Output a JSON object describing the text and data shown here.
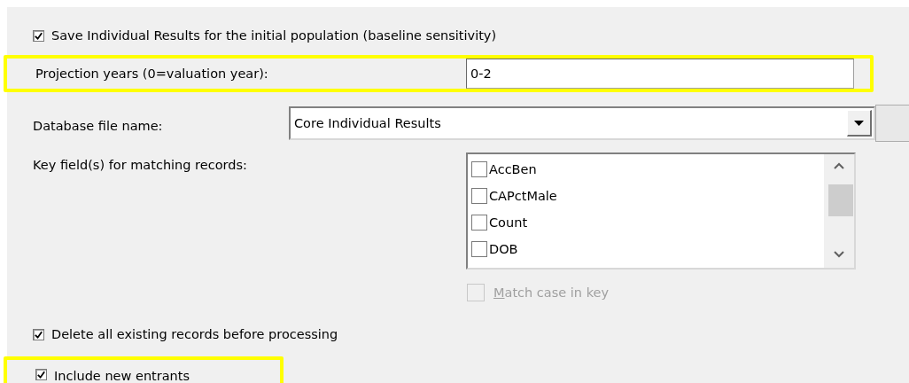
{
  "save_individual": {
    "label": "Save Individual Results for the initial population (baseline sensitivity)",
    "checked": true
  },
  "projection_years": {
    "label": "Projection years (0=valuation year):",
    "value": "0-2",
    "highlighted": true
  },
  "database_file": {
    "label": "Database file name:",
    "value": "Core Individual Results"
  },
  "key_fields": {
    "label": "Key field(s) for matching records:",
    "items": [
      {
        "label": "AccBen",
        "checked": false
      },
      {
        "label": "CAPctMale",
        "checked": false
      },
      {
        "label": "Count",
        "checked": false
      },
      {
        "label": "DOB",
        "checked": false
      }
    ]
  },
  "match_case": {
    "label": "Match case in key",
    "checked": false,
    "disabled": true,
    "first_letter_underlined": true
  },
  "delete_existing": {
    "label": "Delete all existing records before processing",
    "checked": true
  },
  "include_new_entrants": {
    "label": "Include new entrants",
    "checked": true,
    "highlighted": true
  }
}
